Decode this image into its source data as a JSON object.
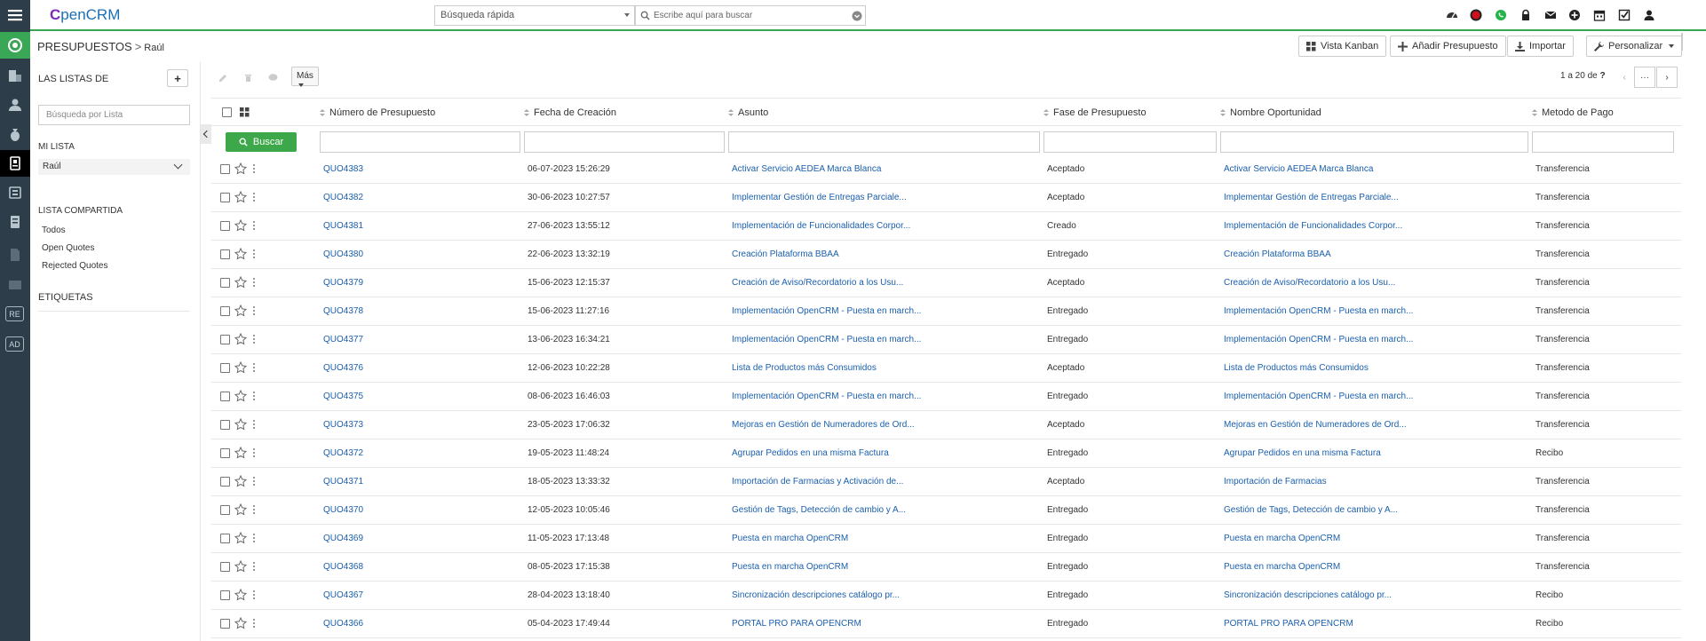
{
  "app": {
    "logo_letter": "C",
    "logo_rest": "penCRM"
  },
  "topbar": {
    "quick_select": "Búsqueda rápida",
    "search_placeholder": "Escribe aquí para buscar",
    "icons": [
      "dashboard-icon",
      "record-icon",
      "whatsapp-icon",
      "lock-icon",
      "mail-icon",
      "add-circle-icon",
      "calendar-icon",
      "checkbox-icon",
      "user-icon"
    ]
  },
  "breadcrumb": {
    "module": "PRESUPUESTOS",
    "separator": ">",
    "current": "Raúl"
  },
  "header_buttons": {
    "kanban": "Vista Kanban",
    "add": "Añadir Presupuesto",
    "import": "Importar",
    "customize": "Personalizar"
  },
  "sidebar": {
    "title": "LAS LISTAS DE",
    "add": "+",
    "search_placeholder": "Búsqueda por Lista",
    "my_list_label": "MI LISTA",
    "my_list_selected": "Raúl",
    "shared_label": "LISTA COMPARTIDA",
    "shared_items": [
      "Todos",
      "Open Quotes",
      "Rejected Quotes"
    ],
    "tags_label": "ETIQUETAS"
  },
  "rail": {
    "boxes": [
      "RE",
      "AD"
    ]
  },
  "toolbar": {
    "more": "Más"
  },
  "pager": {
    "range": "1 a 20",
    "of": "de",
    "total": "?",
    "more": "···"
  },
  "table": {
    "columns": [
      "Número de Presupuesto",
      "Fecha de Creación",
      "Asunto",
      "Fase de Presupuesto",
      "Nombre Oportunidad",
      "Metodo de Pago"
    ],
    "search_button": "Buscar",
    "rows": [
      {
        "num": "QUO4383",
        "date": "06-07-2023 15:26:29",
        "subject": "Activar Servicio AEDEA Marca Blanca",
        "phase": "Aceptado",
        "opportunity": "Activar Servicio AEDEA Marca Blanca",
        "payment": "Transferencia"
      },
      {
        "num": "QUO4382",
        "date": "30-06-2023 10:27:57",
        "subject": "Implementar Gestión de Entregas Parciale...",
        "phase": "Aceptado",
        "opportunity": "Implementar Gestión de Entregas Parciale...",
        "payment": "Transferencia"
      },
      {
        "num": "QUO4381",
        "date": "27-06-2023 13:55:12",
        "subject": "Implementación de Funcionalidades Corpor...",
        "phase": "Creado",
        "opportunity": "Implementación de Funcionalidades Corpor...",
        "payment": "Transferencia"
      },
      {
        "num": "QUO4380",
        "date": "22-06-2023 13:32:19",
        "subject": "Creación Plataforma BBAA",
        "phase": "Entregado",
        "opportunity": "Creación Plataforma BBAA",
        "payment": "Transferencia"
      },
      {
        "num": "QUO4379",
        "date": "15-06-2023 12:15:37",
        "subject": "Creación de Aviso/Recordatorio a los Usu...",
        "phase": "Aceptado",
        "opportunity": "Creación de Aviso/Recordatorio a los Usu...",
        "payment": "Transferencia"
      },
      {
        "num": "QUO4378",
        "date": "15-06-2023 11:27:16",
        "subject": "Implementación OpenCRM - Puesta en march...",
        "phase": "Entregado",
        "opportunity": "Implementación OpenCRM - Puesta en march...",
        "payment": "Transferencia"
      },
      {
        "num": "QUO4377",
        "date": "13-06-2023 16:34:21",
        "subject": "Implementación OpenCRM - Puesta en march...",
        "phase": "Entregado",
        "opportunity": "Implementación OpenCRM - Puesta en march...",
        "payment": "Transferencia"
      },
      {
        "num": "QUO4376",
        "date": "12-06-2023 10:22:28",
        "subject": "Lista de Productos más Consumidos",
        "phase": "Aceptado",
        "opportunity": "Lista de Productos más Consumidos",
        "payment": "Transferencia"
      },
      {
        "num": "QUO4375",
        "date": "08-06-2023 16:46:03",
        "subject": "Implementación OpenCRM - Puesta en march...",
        "phase": "Entregado",
        "opportunity": "Implementación OpenCRM - Puesta en march...",
        "payment": "Transferencia"
      },
      {
        "num": "QUO4373",
        "date": "23-05-2023 17:06:32",
        "subject": "Mejoras en Gestión de Numeradores de Ord...",
        "phase": "Aceptado",
        "opportunity": "Mejoras en Gestión de Numeradores de Ord...",
        "payment": "Transferencia"
      },
      {
        "num": "QUO4372",
        "date": "19-05-2023 11:48:24",
        "subject": "Agrupar Pedidos en una misma Factura",
        "phase": "Entregado",
        "opportunity": "Agrupar Pedidos en una misma Factura",
        "payment": "Recibo"
      },
      {
        "num": "QUO4371",
        "date": "18-05-2023 13:33:32",
        "subject": "Importación de Farmacias y Activación de...",
        "phase": "Aceptado",
        "opportunity": "Importación de Farmacias",
        "payment": "Transferencia"
      },
      {
        "num": "QUO4370",
        "date": "12-05-2023 10:05:46",
        "subject": "Gestión de Tags, Detección de cambio y A...",
        "phase": "Entregado",
        "opportunity": "Gestión de Tags, Detección de cambio y A...",
        "payment": "Transferencia"
      },
      {
        "num": "QUO4369",
        "date": "11-05-2023 17:13:48",
        "subject": "Puesta en marcha OpenCRM",
        "phase": "Entregado",
        "opportunity": "Puesta en marcha OpenCRM",
        "payment": "Transferencia"
      },
      {
        "num": "QUO4368",
        "date": "08-05-2023 17:15:38",
        "subject": "Puesta en marcha OpenCRM",
        "phase": "Entregado",
        "opportunity": "Puesta en marcha OpenCRM",
        "payment": "Transferencia"
      },
      {
        "num": "QUO4367",
        "date": "28-04-2023 13:18:40",
        "subject": "Sincronización descripciones catálogo pr...",
        "phase": "Entregado",
        "opportunity": "Sincronización descripciones catálogo pr...",
        "payment": "Recibo"
      },
      {
        "num": "QUO4366",
        "date": "05-04-2023 17:49:44",
        "subject": "PORTAL PRO PARA OPENCRM",
        "phase": "Entregado",
        "opportunity": "PORTAL PRO PARA OPENCRM",
        "payment": "Recibo"
      }
    ]
  }
}
